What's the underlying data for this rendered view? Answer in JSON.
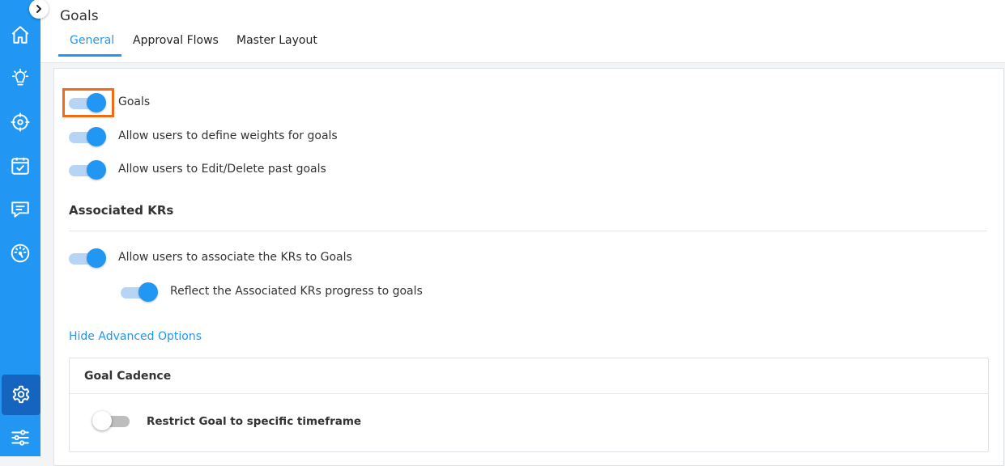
{
  "header": {
    "title": "Goals",
    "tabs": [
      {
        "label": "General",
        "active": true
      },
      {
        "label": "Approval Flows",
        "active": false
      },
      {
        "label": "Master Layout",
        "active": false
      }
    ]
  },
  "sidebar": {
    "items": [
      {
        "icon": "home-icon"
      },
      {
        "icon": "lightbulb-icon"
      },
      {
        "icon": "target-icon"
      },
      {
        "icon": "calendar-check-icon"
      },
      {
        "icon": "chat-icon"
      },
      {
        "icon": "dashboard-gauge-icon"
      },
      {
        "icon": "settings-gear-icon",
        "active": true
      },
      {
        "icon": "sliders-icon"
      }
    ]
  },
  "settings": {
    "goals": {
      "label": "Goals",
      "enabled": true
    },
    "weights": {
      "label": "Allow users to define weights for goals",
      "enabled": true
    },
    "edit_past": {
      "label": "Allow users to Edit/Delete past goals",
      "enabled": true
    },
    "associated_krs_title": "Associated KRs",
    "associate_krs": {
      "label": "Allow users to associate the KRs to Goals",
      "enabled": true
    },
    "reflect_progress": {
      "label": "Reflect the Associated KRs progress to goals",
      "enabled": true
    },
    "advanced_link": "Hide Advanced Options",
    "cadence": {
      "title": "Goal Cadence",
      "restrict": {
        "label": "Restrict Goal to specific timeframe",
        "enabled": false
      }
    }
  },
  "colors": {
    "accent": "#2196f3",
    "highlight": "#f26a14",
    "sidebar_active": "#1565c0"
  }
}
